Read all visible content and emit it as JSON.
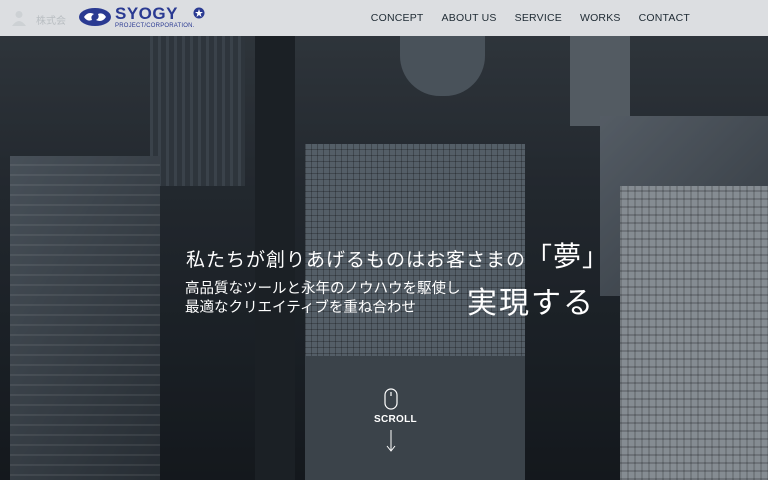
{
  "brand": {
    "name": "SYOGY",
    "tagline": "PROJECT/CORPORATION.",
    "primary_color": "#2a3a92"
  },
  "sidebar": {
    "label": "株式会"
  },
  "nav": {
    "items": [
      {
        "label": "CONCEPT"
      },
      {
        "label": "ABOUT US"
      },
      {
        "label": "SERVICE"
      },
      {
        "label": "WORKS"
      },
      {
        "label": "CONTACT"
      }
    ]
  },
  "hero": {
    "catch_prefix": "私たちが創りあげるものはお客さまの",
    "bracket_open": "「",
    "catch_keyword": "夢",
    "bracket_close": "」",
    "lead_line1": "高品質なツールと永年のノウハウを駆使し",
    "lead_line2": "最適なクリエイティブを重ね合わせ",
    "realize": "実現する"
  },
  "scroll": {
    "label": "SCROLL",
    "mouse_icon": "mouse-icon",
    "arrow_icon": "arrow-down-icon"
  }
}
